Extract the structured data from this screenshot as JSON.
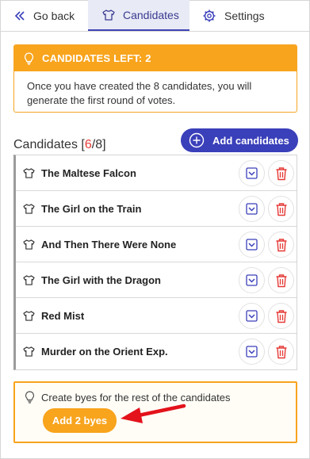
{
  "tabs": {
    "back_label": "Go back",
    "candidates_label": "Candidates",
    "settings_label": "Settings"
  },
  "notice": {
    "title": "CANDIDATES LEFT: 2",
    "message": "Once you have created the 8 candidates, you will generate the first round of votes."
  },
  "candidates": {
    "heading": "Candidates",
    "count_current": "6",
    "count_total": "8",
    "add_label": "Add candidates",
    "items": [
      {
        "label": "The Maltese Falcon"
      },
      {
        "label": "The Girl on the Train"
      },
      {
        "label": "And Then There Were None"
      },
      {
        "label": "The Girl with the Dragon"
      },
      {
        "label": "Red Mist"
      },
      {
        "label": "Murder on the Orient Exp."
      }
    ]
  },
  "byes": {
    "message": "Create byes for the rest of the candidates",
    "button_label": "Add 2 byes"
  },
  "colors": {
    "accent": "#3a3fba",
    "warning": "#f8a41d",
    "danger": "#e53935"
  }
}
